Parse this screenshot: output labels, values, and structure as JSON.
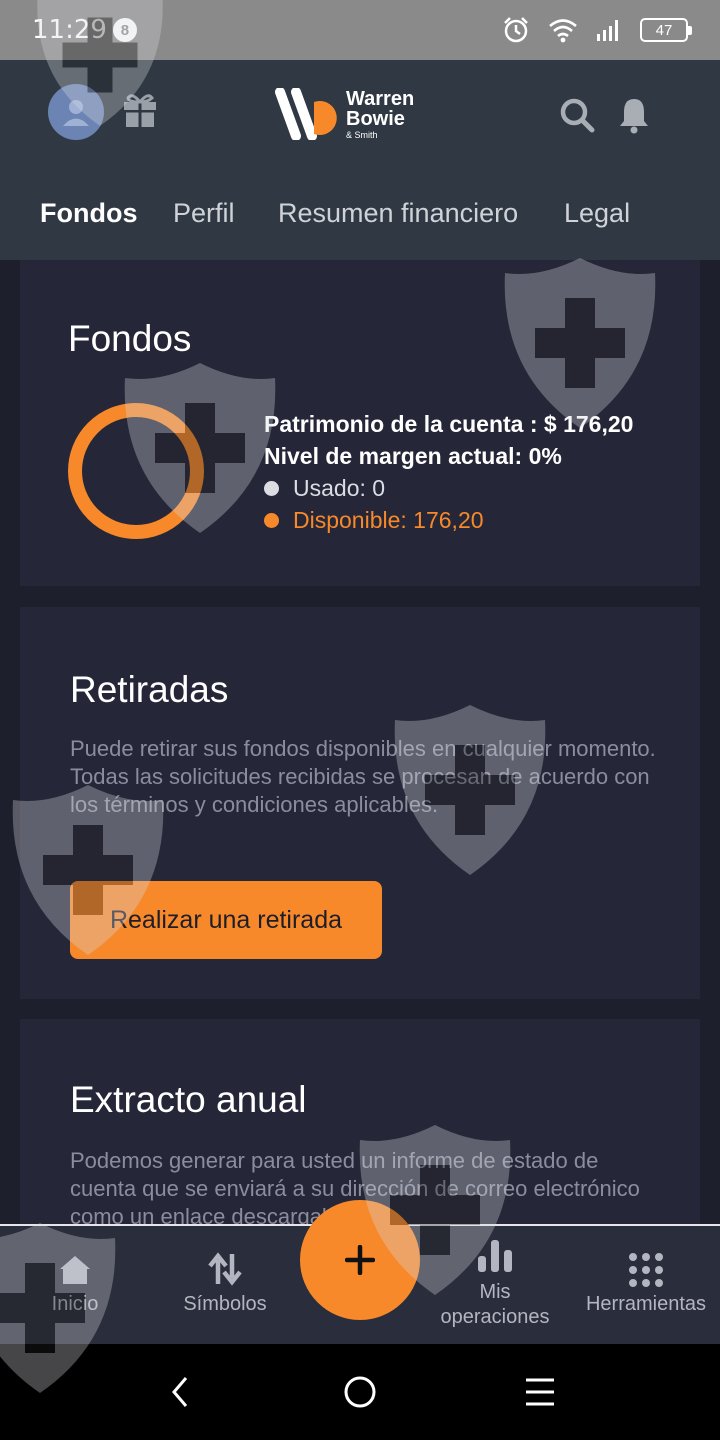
{
  "status_bar": {
    "time": "11:29",
    "notification_count": "8",
    "battery": "47"
  },
  "header": {
    "logo_line1": "Warren",
    "logo_line2": "Bowie",
    "logo_line3": "& Smith",
    "tabs": [
      {
        "label": "Fondos",
        "active": true
      },
      {
        "label": "Perfil",
        "active": false
      },
      {
        "label": "Resumen financiero",
        "active": false
      },
      {
        "label": "Legal",
        "active": false
      }
    ]
  },
  "funds": {
    "title": "Fondos",
    "equity": "Patrimonio de la cuenta : $ 176,20",
    "margin_level": "Nivel de margen actual: 0%",
    "used": "Usado: 0",
    "available": "Disponible: 176,20",
    "used_fraction": 0,
    "colors": {
      "used": "#dcdde3",
      "available": "#f7892a"
    }
  },
  "withdrawals": {
    "title": "Retiradas",
    "description": "Puede retirar sus fondos disponibles en cualquier momento. Todas las solicitudes recibidas se procesan de acuerdo con los términos y condiciones aplicables.",
    "button": "Realizar una retirada"
  },
  "statement": {
    "title": "Extracto anual",
    "description": "Podemos generar para usted un informe de estado de cuenta que se enviará a su dirección de correo electrónico como un enlace descargable."
  },
  "bottom_nav": {
    "items": [
      {
        "label": "Inicio",
        "icon": "home-icon"
      },
      {
        "label": "Símbolos",
        "icon": "swap-arrows-icon"
      },
      {
        "label": "Mis operaciones",
        "icon": "bar-chart-icon"
      },
      {
        "label": "Herramientas",
        "icon": "grid-icon"
      }
    ],
    "fab_icon": "plus-icon"
  },
  "accent_color": "#f7892a"
}
